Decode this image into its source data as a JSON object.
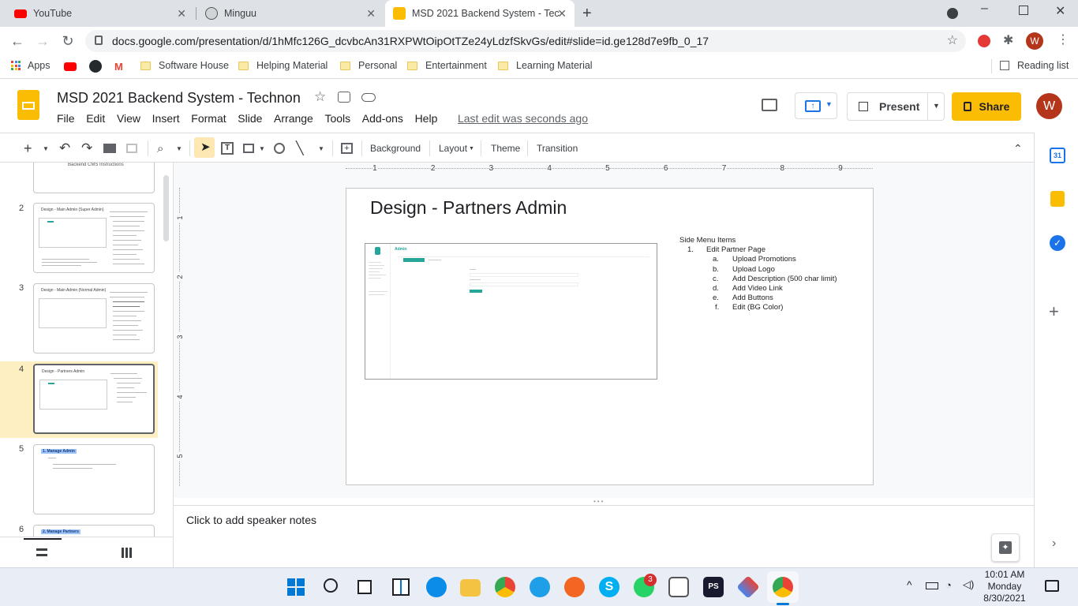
{
  "browser": {
    "tabs": [
      {
        "title": "YouTube"
      },
      {
        "title": "Minguu"
      },
      {
        "title": "MSD 2021 Backend System - Tec"
      }
    ],
    "url": "docs.google.com/presentation/d/1hMfc126G_dcvbcAn31RXPWtOipOtTZe24yLdzfSkvGs/edit#slide=id.ge128d7e9fb_0_17",
    "profile_initial": "W",
    "bookmarks": [
      "Apps",
      "Software House",
      "Helping Material",
      "Personal",
      "Entertainment",
      "Learning Material"
    ],
    "reading_list": "Reading list"
  },
  "doc": {
    "title": "MSD 2021 Backend System - Technon",
    "menus": [
      "File",
      "Edit",
      "View",
      "Insert",
      "Format",
      "Slide",
      "Arrange",
      "Tools",
      "Add-ons",
      "Help"
    ],
    "last_edit": "Last edit was seconds ago",
    "present_label": "Present",
    "share_label": "Share",
    "avatar_initial": "W"
  },
  "toolbar": {
    "background": "Background",
    "layout": "Layout",
    "theme": "Theme",
    "transition": "Transition"
  },
  "ruler": [
    "1",
    "2",
    "3",
    "4",
    "5",
    "6",
    "7",
    "8",
    "9"
  ],
  "vruler": [
    "1",
    "2",
    "3",
    "4",
    "5"
  ],
  "filmstrip": {
    "slide1_caption": "Backend CMS Instructions",
    "slides": [
      {
        "num": "2",
        "title": "Design - Main Admin (Super Admin)"
      },
      {
        "num": "3",
        "title": "Design - Main Admin (Normal Admin)"
      },
      {
        "num": "4",
        "title": "Design - Partners Admin"
      },
      {
        "num": "5",
        "title": "1.   Manage Admin"
      },
      {
        "num": "6",
        "title": "2. Manage Partners"
      }
    ]
  },
  "slide": {
    "title": "Design - Partners Admin",
    "mock_brand": "Admin",
    "list_heading": "Side Menu Items",
    "items": [
      {
        "marker": "1.",
        "text": "Edit Partner Page"
      },
      {
        "marker": "a.",
        "text": "Upload Promotions"
      },
      {
        "marker": "b.",
        "text": "Upload Logo"
      },
      {
        "marker": "c.",
        "text": "Add Description (500 char limit)"
      },
      {
        "marker": "d.",
        "text": "Add Video Link"
      },
      {
        "marker": "e.",
        "text": "Add Buttons"
      },
      {
        "marker": "f.",
        "text": "Edit (BG Color)"
      }
    ]
  },
  "notes": {
    "placeholder": "Click to add speaker notes"
  },
  "taskbar": {
    "time": "10:01 AM",
    "day": "Monday",
    "date": "8/30/2021",
    "badge": "3"
  },
  "colors": {
    "accent": "#fbbc04",
    "google_blue": "#1a73e8",
    "avatar": "#b5351a",
    "teal": "#26a69a"
  }
}
